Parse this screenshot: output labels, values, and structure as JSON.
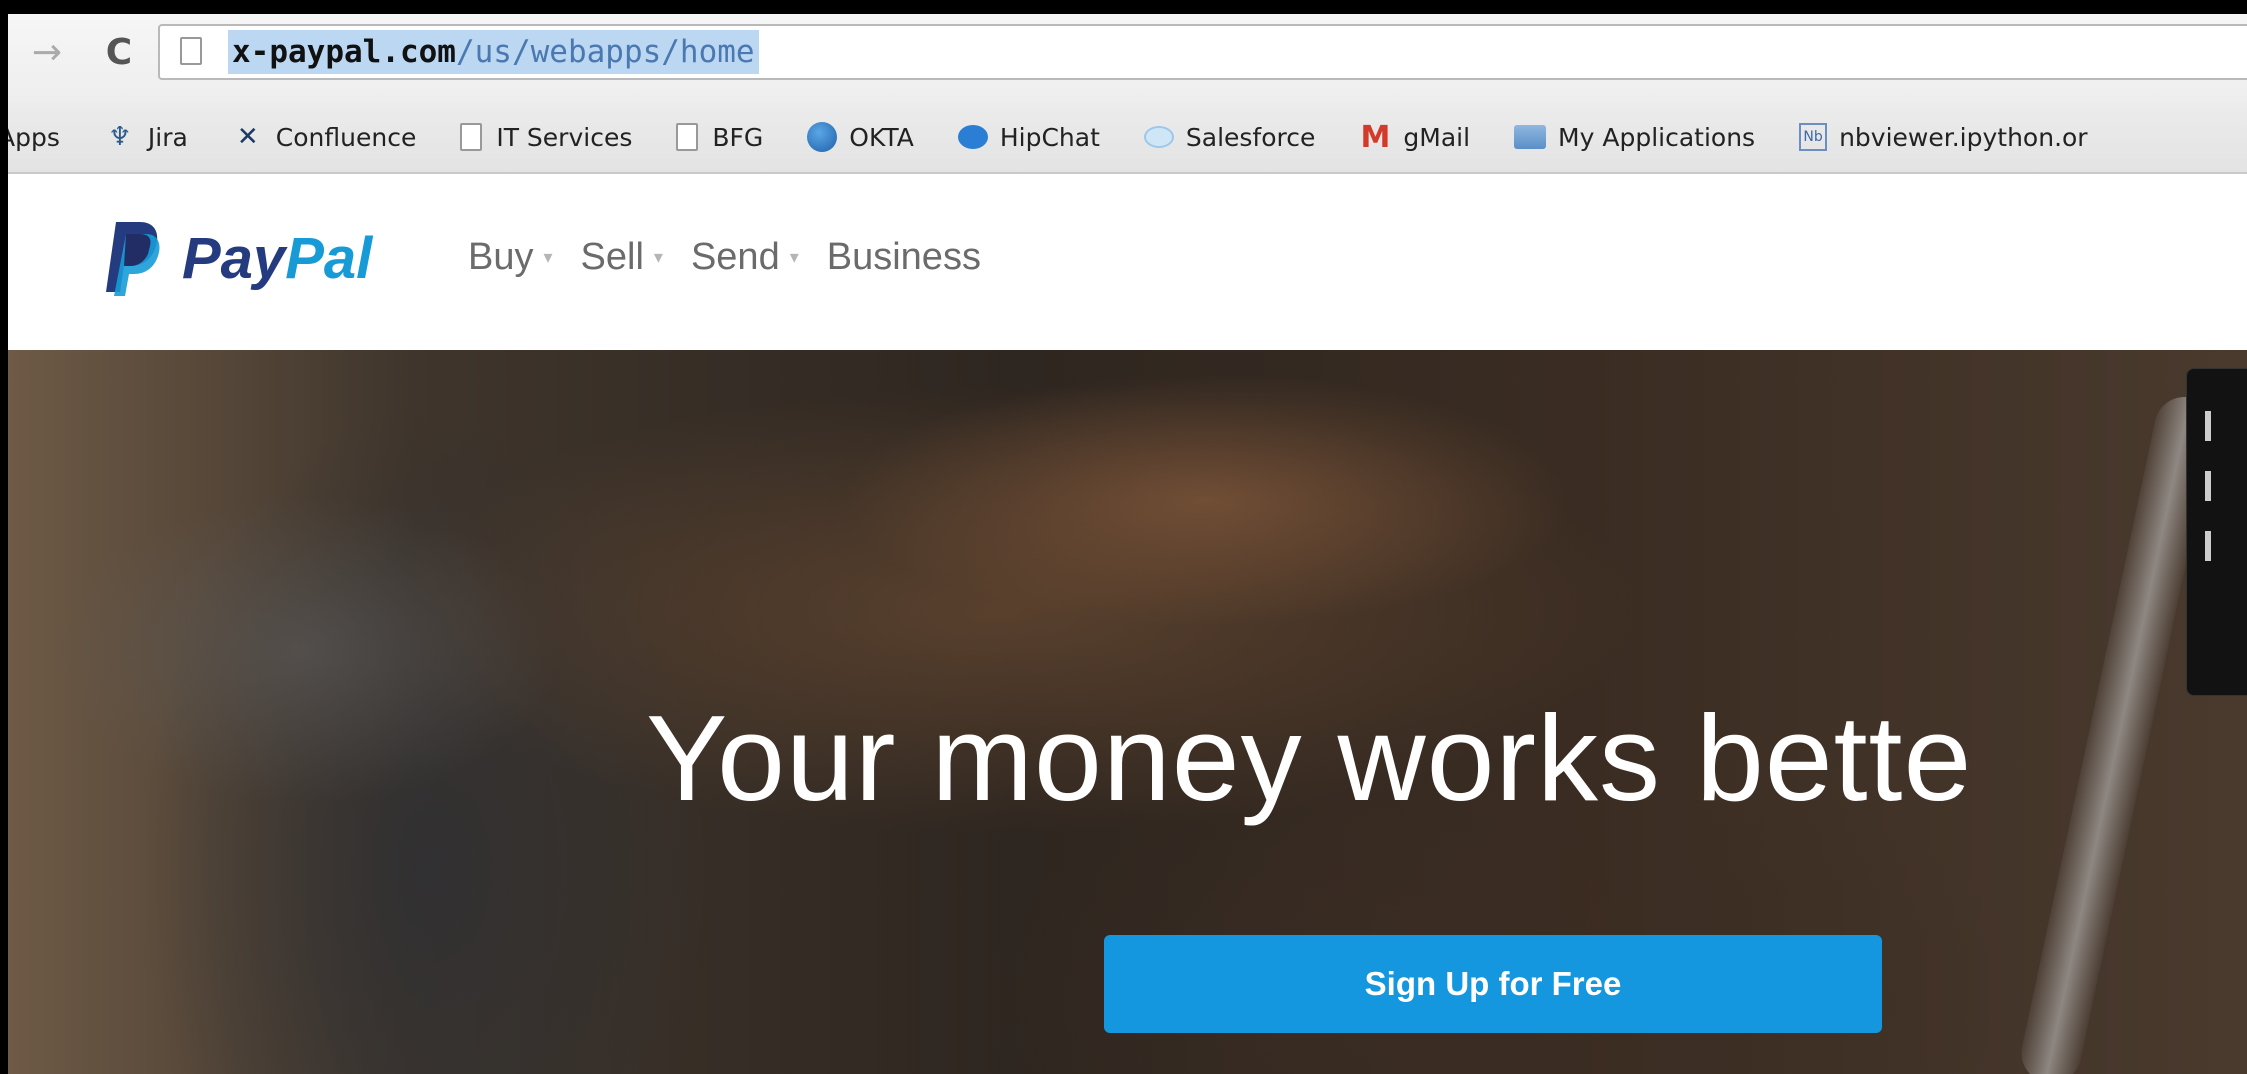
{
  "browser": {
    "forward_icon": "arrow-right-icon",
    "reload_icon": "reload-icon",
    "address": {
      "host": "x-paypal.com",
      "path": "/us/webapps/home"
    }
  },
  "bookmarks": [
    {
      "label": "Apps",
      "icon": "apps-icon"
    },
    {
      "label": "Jira",
      "icon": "jira-icon"
    },
    {
      "label": "Confluence",
      "icon": "confluence-icon"
    },
    {
      "label": "IT Services",
      "icon": "page-icon"
    },
    {
      "label": "BFG",
      "icon": "page-icon"
    },
    {
      "label": "OKTA",
      "icon": "okta-icon"
    },
    {
      "label": "HipChat",
      "icon": "hipchat-icon"
    },
    {
      "label": "Salesforce",
      "icon": "salesforce-icon"
    },
    {
      "label": "gMail",
      "icon": "gmail-icon"
    },
    {
      "label": "My Applications",
      "icon": "folder-icon"
    },
    {
      "label": "nbviewer.ipython.or",
      "icon": "nb-icon"
    }
  ],
  "paypal": {
    "logo": {
      "pay": "Pay",
      "pal": "Pal"
    },
    "nav": [
      {
        "label": "Buy",
        "has_caret": true
      },
      {
        "label": "Sell",
        "has_caret": true
      },
      {
        "label": "Send",
        "has_caret": true
      },
      {
        "label": "Business",
        "has_caret": false
      }
    ],
    "colors": {
      "pay": "#253b80",
      "pal": "#179bd7",
      "cta": "#1497de"
    }
  },
  "hero": {
    "title": "Your money works bette",
    "cta_label": "Sign Up for Free"
  }
}
